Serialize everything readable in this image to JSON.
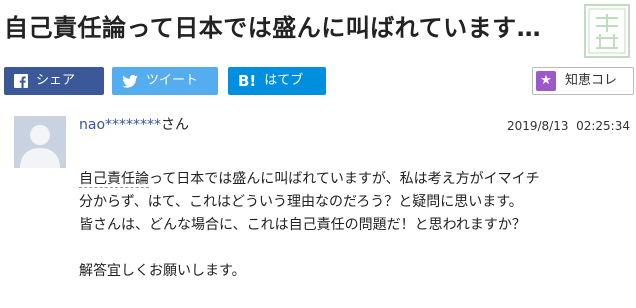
{
  "question_title": "自己責任論って日本では盛んに叫ばれています…",
  "share": {
    "facebook_label": "シェア",
    "twitter_label": "ツイート",
    "hatena_label": "はてブ",
    "hatena_mark": "B!"
  },
  "chiekore": {
    "label": "知恵コレ"
  },
  "post": {
    "username": "nao********",
    "honorific": "さん",
    "timestamp": "2019/8/13  02:25:34",
    "line1_link": "自己責任論",
    "line1_rest": "って日本では盛んに叫ばれていますが、私は考え方がイマイチ",
    "line2": "分からず、はて、これはどういう理由なのだろう？と疑問に思います。",
    "line3": "皆さんは、どんな場合に、これは自己責任の問題だ！と思われますか？",
    "line5": "解答宜しくお願いします。"
  },
  "colors": {
    "facebook": "#3b5998",
    "twitter": "#55acee",
    "hatena": "#008fde",
    "username_link": "#3a52a3",
    "chiekore_star": "#9b59c9"
  },
  "icons": [
    "facebook-icon",
    "twitter-icon",
    "hatena-icon",
    "star-icon",
    "avatar-icon"
  ]
}
